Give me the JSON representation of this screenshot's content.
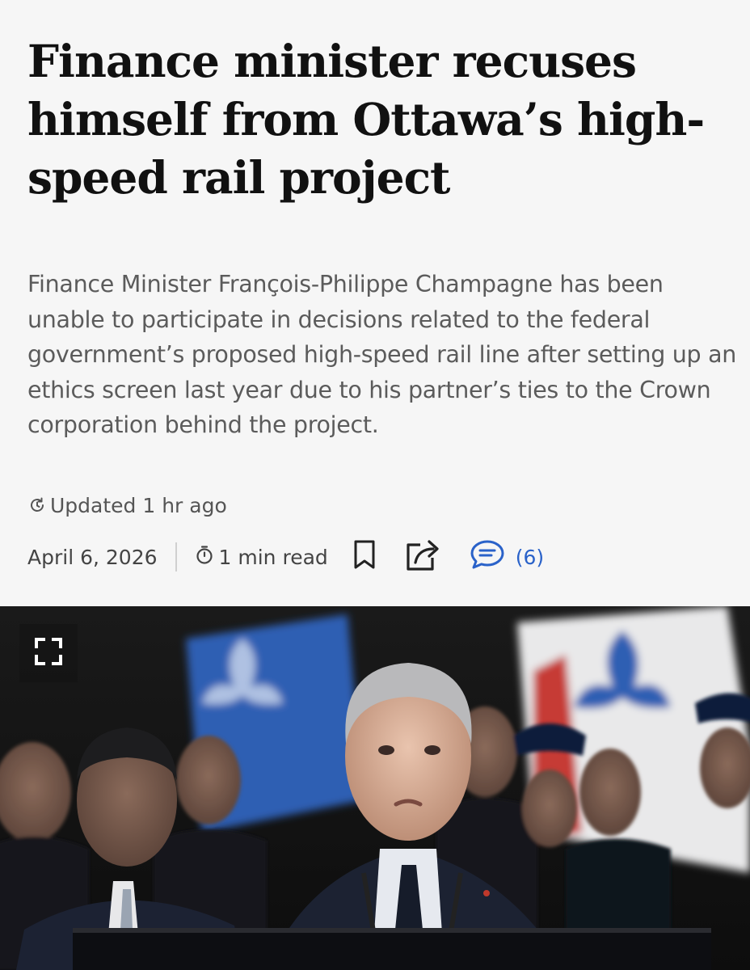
{
  "article": {
    "headline": "Finance minister recuses himself from Ottawa’s high-speed rail project",
    "dek": "Finance Minister François-Philippe Champagne has been unable to participate in decisions related to the federal government’s proposed high-speed rail line after setting up an ethics screen last year due to his partner’s ties to the Crown corporation behind the project.",
    "updated_label": "Updated 1 hr ago",
    "date": "April 6, 2026",
    "read_time": "1 min read",
    "comment_count": "(6)"
  },
  "icons": {
    "updated": "refresh-clock-icon",
    "read_time": "stopwatch-icon",
    "bookmark": "bookmark-icon",
    "share": "share-icon",
    "comments": "speech-bubble-icon",
    "expand": "expand-fullscreen-icon"
  },
  "colors": {
    "background": "#f6f6f6",
    "headline": "#111111",
    "dek": "#5b5b5b",
    "meta": "#444444",
    "accent": "#2a62c9"
  }
}
